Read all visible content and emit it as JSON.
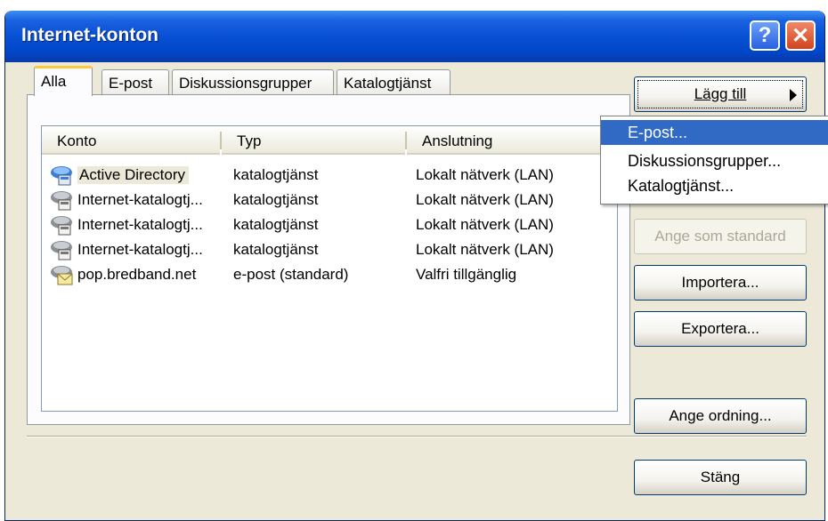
{
  "window": {
    "title": "Internet-konton"
  },
  "titlebar": {
    "help_icon": "question-icon",
    "close_icon": "close-x-icon",
    "help_glyph": "?",
    "close_glyph": "✕"
  },
  "tabs": [
    {
      "label": "Alla",
      "active": true
    },
    {
      "label": "E-post",
      "active": false
    },
    {
      "label": "Diskussionsgrupper",
      "active": false
    },
    {
      "label": "Katalogtjänst",
      "active": false
    }
  ],
  "list": {
    "columns": [
      "Konto",
      "Typ",
      "Anslutning"
    ],
    "rows": [
      {
        "konto": "Active Directory",
        "typ": "katalogtjänst",
        "anslutning": "Lokalt nätverk (LAN)",
        "icon": "directory-service-icon",
        "selected": true
      },
      {
        "konto": "Internet-katalogtj...",
        "typ": "katalogtjänst",
        "anslutning": "Lokalt nätverk (LAN)",
        "icon": "directory-service-icon"
      },
      {
        "konto": "Internet-katalogtj...",
        "typ": "katalogtjänst",
        "anslutning": "Lokalt nätverk (LAN)",
        "icon": "directory-service-icon"
      },
      {
        "konto": "Internet-katalogtj...",
        "typ": "katalogtjänst",
        "anslutning": "Lokalt nätverk (LAN)",
        "icon": "directory-service-icon"
      },
      {
        "konto": "pop.bredband.net",
        "typ": "e-post (standard)",
        "anslutning": "Valfri tillgänglig",
        "icon": "mail-account-icon"
      }
    ]
  },
  "buttons": {
    "add": "Lägg till",
    "set_default": "Ange som standard",
    "import": "Importera...",
    "export": "Exportera...",
    "order": "Ange ordning...",
    "close": "Stäng"
  },
  "add_menu": {
    "items": [
      "E-post...",
      "Diskussionsgrupper...",
      "Katalogtjänst..."
    ],
    "highlighted_index": 0
  },
  "colors": {
    "title_blue": "#0054e3",
    "selection_blue": "#316ac5",
    "dialog_face": "#ece9d8",
    "tab_accent": "#ffc83c"
  }
}
